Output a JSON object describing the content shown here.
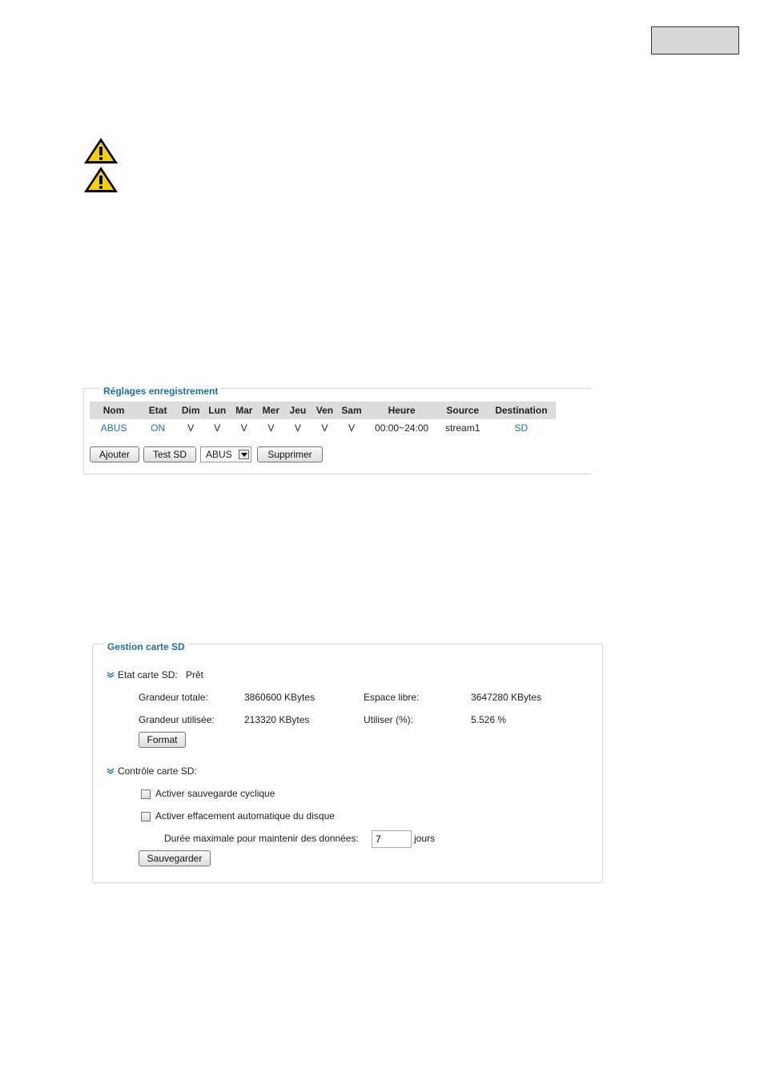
{
  "recording": {
    "legend": "Réglages enregistrement",
    "columns": [
      "Nom",
      "Etat",
      "Dim",
      "Lun",
      "Mar",
      "Mer",
      "Jeu",
      "Ven",
      "Sam",
      "Heure",
      "Source",
      "Destination"
    ],
    "row": {
      "nom": "ABUS",
      "etat": "ON",
      "dim": "V",
      "lun": "V",
      "mar": "V",
      "mer": "V",
      "jeu": "V",
      "ven": "V",
      "sam": "V",
      "heure": "00:00~24:00",
      "source": "stream1",
      "destination": "SD"
    },
    "buttons": {
      "add": "Ajouter",
      "test_sd": "Test SD",
      "delete": "Supprimer"
    },
    "select_value": "ABUS"
  },
  "sd": {
    "legend": "Gestion carte SD",
    "status_label": "Etat carte SD:",
    "status_value": "Prêt",
    "total_label": "Grandeur totale:",
    "total_value": "3860600  KBytes",
    "free_label": "Espace libre:",
    "free_value": "3647280  KBytes",
    "used_label": "Grandeur utilisée:",
    "used_value": "213320  KBytes",
    "use_pct_label": "Utiliser (%):",
    "use_pct_value": "5.526 %",
    "format_button": "Format",
    "control_label": "Contrôle carte SD:",
    "cyclic_label": "Activer sauvegarde cyclique",
    "auto_delete_label": "Activer effacement automatique du disque",
    "max_duration_label": "Durée maximale pour maintenir des données:",
    "max_duration_value": "7",
    "days_label": "jours",
    "save_button": "Sauvegarder"
  },
  "colors": {
    "link": "#1f6fb2",
    "warning": "#f5d000",
    "header_bg": "#dcdcdc"
  }
}
